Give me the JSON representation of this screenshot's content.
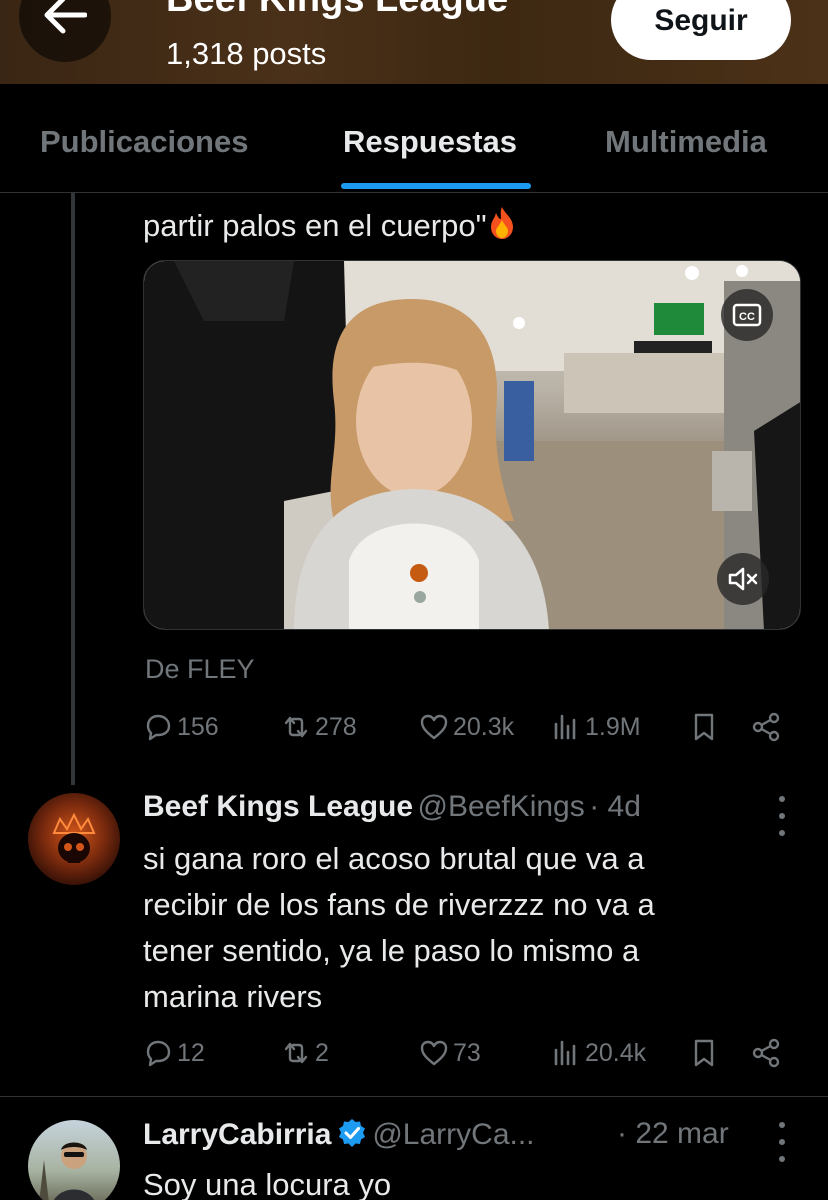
{
  "header": {
    "title": "Beef Kings League",
    "posts_count": "1,318 posts",
    "follow_label": "Seguir"
  },
  "tabs": [
    {
      "label": "Publicaciones",
      "active": false
    },
    {
      "label": "Respuestas",
      "active": true
    },
    {
      "label": "Multimedia",
      "active": false
    }
  ],
  "post1": {
    "text": "partir palos en el cuerpo\"",
    "emoji": "fire",
    "source": "De FLEY",
    "video": {
      "cc_label": "CC"
    },
    "actions": {
      "replies": "156",
      "reposts": "278",
      "likes": "20.3k",
      "views": "1.9M"
    }
  },
  "post2": {
    "name": "Beef Kings League",
    "handle": "@BeefKings",
    "time": "· 4d",
    "lines": [
      "si gana roro el acoso brutal que va a",
      "recibir de los fans de riverzzz no va a",
      "tener sentido, ya le paso lo mismo a",
      "marina rivers"
    ],
    "actions": {
      "replies": "12",
      "reposts": "2",
      "likes": "73",
      "views": "20.4k"
    }
  },
  "post3": {
    "name": "LarryCabirria",
    "handle": "@LarryCa...",
    "time": "· 22 mar",
    "text": "Soy una locura yo",
    "verified_color": "#1d9bf0"
  },
  "colors": {
    "accent": "#1d9bf0",
    "muted": "#71767b",
    "text": "#e7e9ea",
    "banner": "#4a3018"
  }
}
